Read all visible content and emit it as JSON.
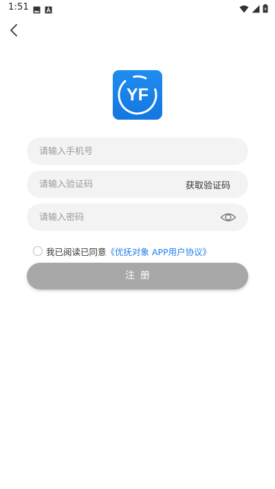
{
  "status_bar": {
    "time": "1:51",
    "left_icons": [
      "image-icon",
      "font-a-icon"
    ],
    "right_icons": [
      "wifi-icon",
      "signal-icon",
      "battery-icon"
    ]
  },
  "nav": {
    "back_icon": "chevron-left-icon"
  },
  "logo": {
    "text": "YF",
    "color": "#1a82ea"
  },
  "form": {
    "phone_placeholder": "请输入手机号",
    "code_placeholder": "请输入验证码",
    "get_code_label": "获取验证码",
    "password_placeholder": "请输入密码",
    "password_visibility_icon": "eye-icon"
  },
  "agreement": {
    "prefix": "我已阅读已同意",
    "link": "《优抚对象 APP用户协议》",
    "checked": false
  },
  "submit": {
    "label": "注册",
    "color": "#a8a8a8"
  }
}
